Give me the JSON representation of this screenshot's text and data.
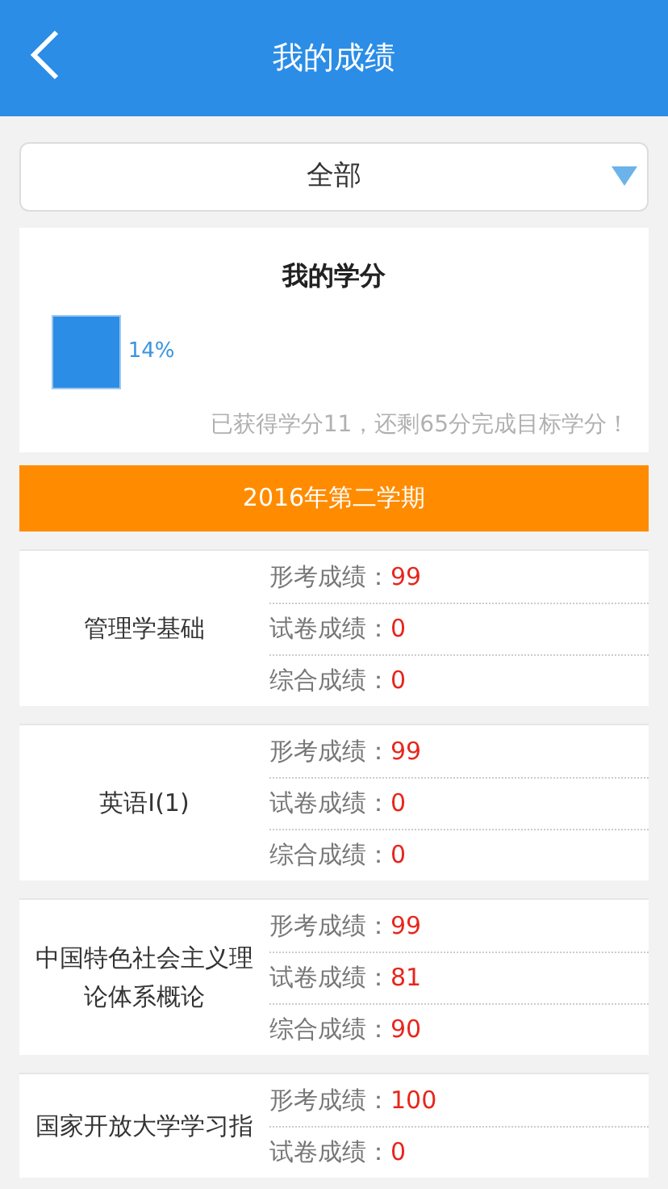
{
  "header": {
    "title": "我的成绩"
  },
  "filter": {
    "value": "全部"
  },
  "credits": {
    "title": "我的学分",
    "level": 0.14,
    "percent": "14%",
    "summary": "已获得学分11，还剩65分完成目标学分！"
  },
  "term": "2016年第二学期",
  "courses": [
    {
      "name": "管理学基础",
      "scores": [
        {
          "label": "形考成绩：",
          "value": "99"
        },
        {
          "label": "试卷成绩：",
          "value": "0"
        },
        {
          "label": "综合成绩：",
          "value": "0"
        }
      ]
    },
    {
      "name": "英语I(1)",
      "scores": [
        {
          "label": "形考成绩：",
          "value": "99"
        },
        {
          "label": "试卷成绩：",
          "value": "0"
        },
        {
          "label": "综合成绩：",
          "value": "0"
        }
      ]
    },
    {
      "name": "中国特色社会主义理论体系概论",
      "scores": [
        {
          "label": "形考成绩：",
          "value": "99"
        },
        {
          "label": "试卷成绩：",
          "value": "81"
        },
        {
          "label": "综合成绩：",
          "value": "90"
        }
      ]
    },
    {
      "name": "国家开放大学学习指",
      "scores": [
        {
          "label": "形考成绩：",
          "value": "100"
        },
        {
          "label": "试卷成绩：",
          "value": "0"
        }
      ]
    }
  ]
}
